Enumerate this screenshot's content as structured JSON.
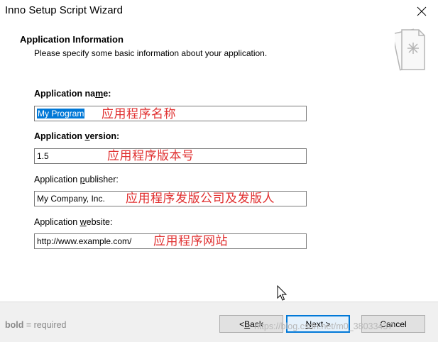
{
  "window": {
    "title": "Inno Setup Script Wizard",
    "close_icon": "close-icon"
  },
  "header": {
    "title": "Application Information",
    "subtitle": "Please specify some basic information about your application.",
    "icon": "wizard-document-icon"
  },
  "fields": [
    {
      "label_pre": "Application na",
      "label_key": "m",
      "label_post": "e:",
      "value": "My Program",
      "annotation": "应用程序名称",
      "required": true
    },
    {
      "label_pre": "Application ",
      "label_key": "v",
      "label_post": "ersion:",
      "value": "1.5",
      "annotation": "应用程序版本号",
      "required": true
    },
    {
      "label_pre": "Application ",
      "label_key": "p",
      "label_post": "ublisher:",
      "value": "My Company, Inc.",
      "annotation": "应用程序发版公司及发版人",
      "required": false
    },
    {
      "label_pre": "Application ",
      "label_key": "w",
      "label_post": "ebsite:",
      "value": "http://www.example.com/",
      "annotation": "应用程序网站",
      "required": false
    }
  ],
  "footer": {
    "required_bold": "bold",
    "required_text": " = required",
    "back_pre": "< ",
    "back_key": "B",
    "back_post": "ack",
    "next_pre": "",
    "next_key": "N",
    "next_post": "ext >",
    "cancel_label": "Cancel",
    "watermark": "https://blog.csdn.net/m0_38033437"
  },
  "colors": {
    "annotation": "#e03030",
    "selection": "#0078d7",
    "default_button_border": "#0078d7"
  }
}
